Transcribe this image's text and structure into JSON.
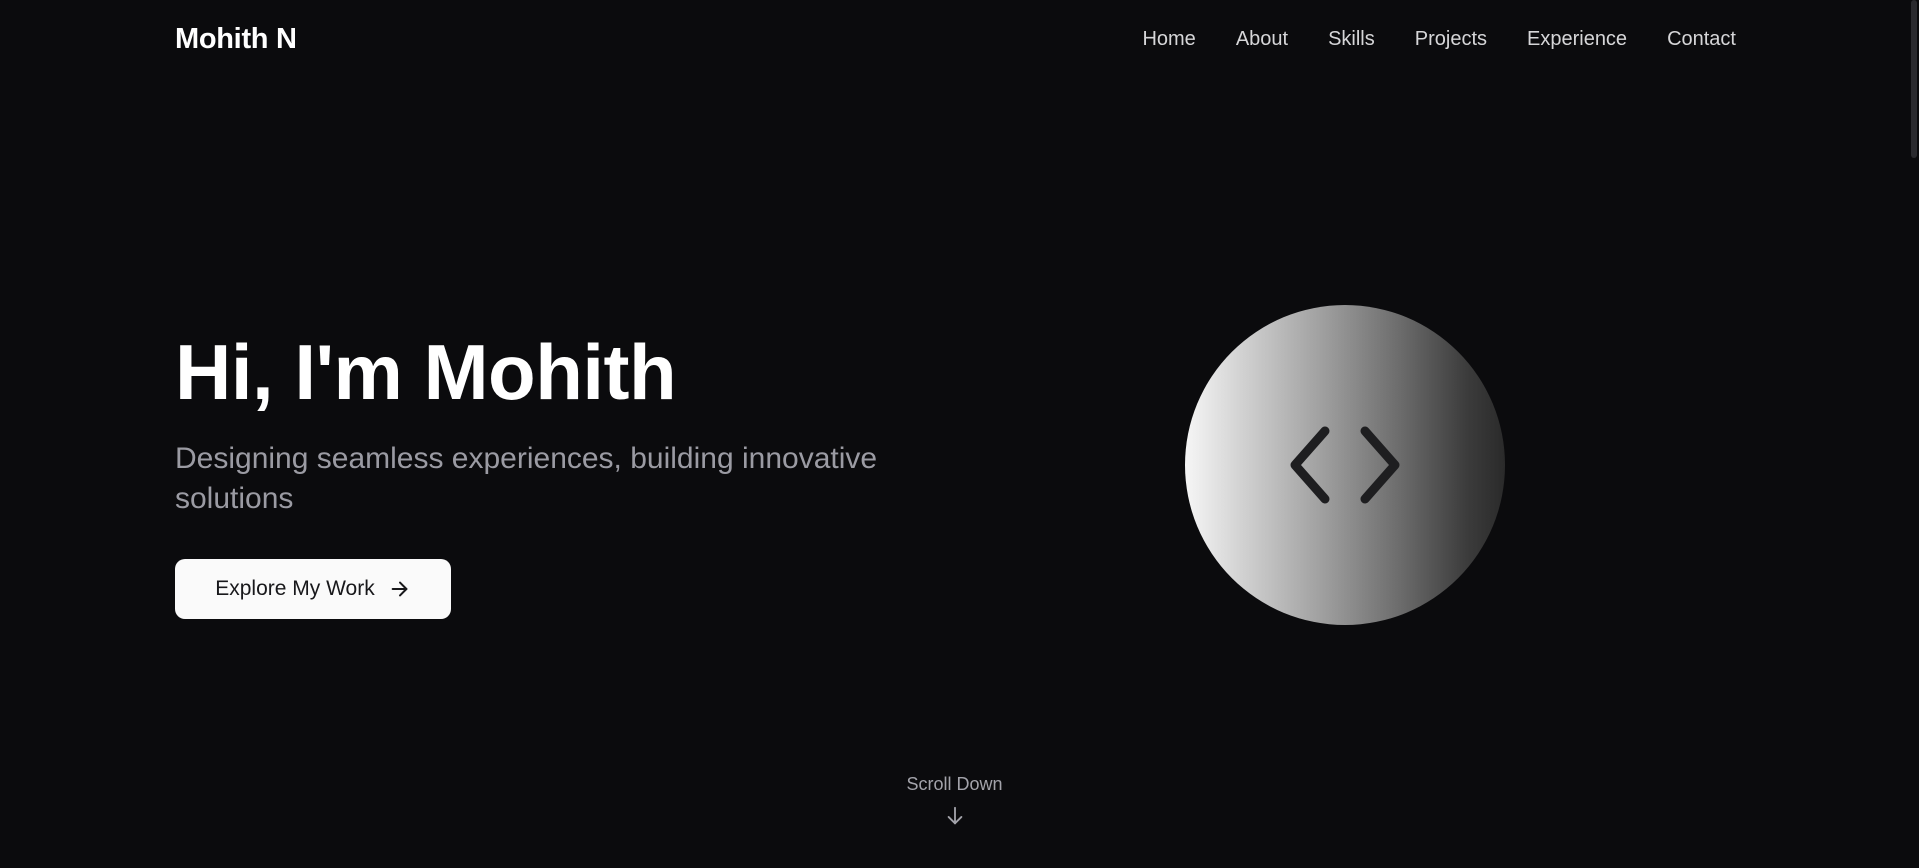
{
  "nav": {
    "logo": "Mohith N",
    "links": [
      {
        "label": "Home"
      },
      {
        "label": "About"
      },
      {
        "label": "Skills"
      },
      {
        "label": "Projects"
      },
      {
        "label": "Experience"
      },
      {
        "label": "Contact"
      }
    ]
  },
  "hero": {
    "title": "Hi, I'm Mohith",
    "subtitle": "Designing seamless experiences, building innovative solutions",
    "cta_label": "Explore My Work",
    "cta_icon": "arrow-right-icon",
    "visual_icon": "code-brackets-icon"
  },
  "scroll": {
    "label": "Scroll Down",
    "icon": "arrow-down-icon"
  },
  "colors": {
    "background": "#0b0b0d",
    "text_primary": "#ffffff",
    "text_muted": "#9b9ba3",
    "button_bg": "#fafafa",
    "button_text": "#18181b"
  }
}
